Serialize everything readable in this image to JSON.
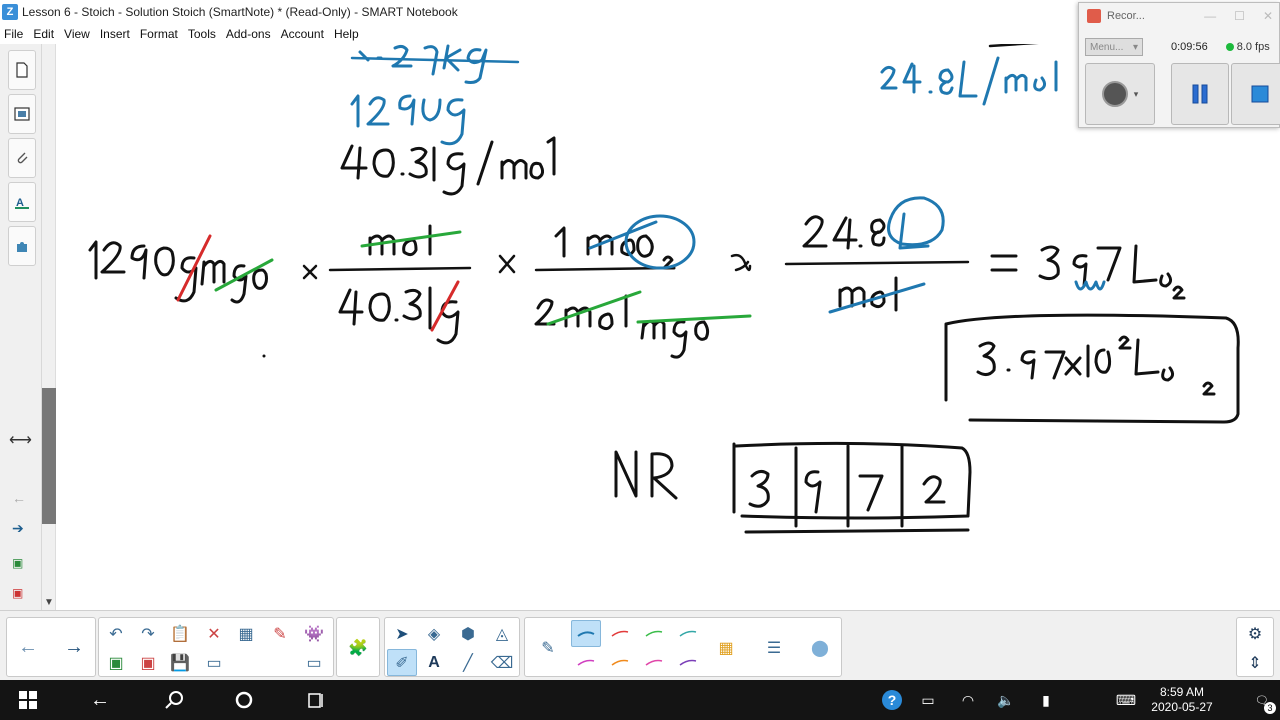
{
  "window": {
    "title": "Lesson 6 - Stoich - Solution Stoich (SmartNote) * (Read-Only) - SMART Notebook",
    "icon_letter": "Z"
  },
  "menu": [
    "File",
    "Edit",
    "View",
    "Insert",
    "Format",
    "Tools",
    "Add-ons",
    "Account",
    "Help"
  ],
  "sidebar": {
    "tabs": [
      "page-sorter-icon",
      "gallery-icon",
      "attachments-icon",
      "properties-icon",
      "add-ons-icon"
    ]
  },
  "recorder": {
    "title": "Recor...",
    "menu_label": "Menu...",
    "time": "0:09:56",
    "fps": "8.0 fps",
    "status_color": "#1cba3c"
  },
  "taskbar": {
    "time": "8:59 AM",
    "date": "2020-05-27",
    "notification_count": "3"
  },
  "colors": {
    "ink_black": "#111111",
    "ink_blue": "#1f78b0",
    "ink_green": "#28a83a",
    "ink_red": "#d62b2b",
    "toolbar_selected": "#bfe0f8"
  }
}
